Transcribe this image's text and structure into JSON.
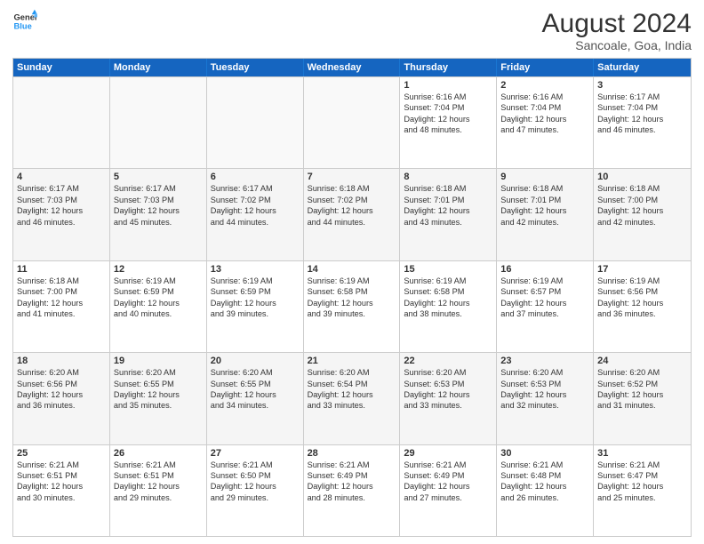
{
  "logo": {
    "line1": "General",
    "line2": "Blue"
  },
  "title": "August 2024",
  "subtitle": "Sancoale, Goa, India",
  "header_days": [
    "Sunday",
    "Monday",
    "Tuesday",
    "Wednesday",
    "Thursday",
    "Friday",
    "Saturday"
  ],
  "weeks": [
    [
      {
        "day": "",
        "info": ""
      },
      {
        "day": "",
        "info": ""
      },
      {
        "day": "",
        "info": ""
      },
      {
        "day": "",
        "info": ""
      },
      {
        "day": "1",
        "info": "Sunrise: 6:16 AM\nSunset: 7:04 PM\nDaylight: 12 hours\nand 48 minutes."
      },
      {
        "day": "2",
        "info": "Sunrise: 6:16 AM\nSunset: 7:04 PM\nDaylight: 12 hours\nand 47 minutes."
      },
      {
        "day": "3",
        "info": "Sunrise: 6:17 AM\nSunset: 7:04 PM\nDaylight: 12 hours\nand 46 minutes."
      }
    ],
    [
      {
        "day": "4",
        "info": "Sunrise: 6:17 AM\nSunset: 7:03 PM\nDaylight: 12 hours\nand 46 minutes."
      },
      {
        "day": "5",
        "info": "Sunrise: 6:17 AM\nSunset: 7:03 PM\nDaylight: 12 hours\nand 45 minutes."
      },
      {
        "day": "6",
        "info": "Sunrise: 6:17 AM\nSunset: 7:02 PM\nDaylight: 12 hours\nand 44 minutes."
      },
      {
        "day": "7",
        "info": "Sunrise: 6:18 AM\nSunset: 7:02 PM\nDaylight: 12 hours\nand 44 minutes."
      },
      {
        "day": "8",
        "info": "Sunrise: 6:18 AM\nSunset: 7:01 PM\nDaylight: 12 hours\nand 43 minutes."
      },
      {
        "day": "9",
        "info": "Sunrise: 6:18 AM\nSunset: 7:01 PM\nDaylight: 12 hours\nand 42 minutes."
      },
      {
        "day": "10",
        "info": "Sunrise: 6:18 AM\nSunset: 7:00 PM\nDaylight: 12 hours\nand 42 minutes."
      }
    ],
    [
      {
        "day": "11",
        "info": "Sunrise: 6:18 AM\nSunset: 7:00 PM\nDaylight: 12 hours\nand 41 minutes."
      },
      {
        "day": "12",
        "info": "Sunrise: 6:19 AM\nSunset: 6:59 PM\nDaylight: 12 hours\nand 40 minutes."
      },
      {
        "day": "13",
        "info": "Sunrise: 6:19 AM\nSunset: 6:59 PM\nDaylight: 12 hours\nand 39 minutes."
      },
      {
        "day": "14",
        "info": "Sunrise: 6:19 AM\nSunset: 6:58 PM\nDaylight: 12 hours\nand 39 minutes."
      },
      {
        "day": "15",
        "info": "Sunrise: 6:19 AM\nSunset: 6:58 PM\nDaylight: 12 hours\nand 38 minutes."
      },
      {
        "day": "16",
        "info": "Sunrise: 6:19 AM\nSunset: 6:57 PM\nDaylight: 12 hours\nand 37 minutes."
      },
      {
        "day": "17",
        "info": "Sunrise: 6:19 AM\nSunset: 6:56 PM\nDaylight: 12 hours\nand 36 minutes."
      }
    ],
    [
      {
        "day": "18",
        "info": "Sunrise: 6:20 AM\nSunset: 6:56 PM\nDaylight: 12 hours\nand 36 minutes."
      },
      {
        "day": "19",
        "info": "Sunrise: 6:20 AM\nSunset: 6:55 PM\nDaylight: 12 hours\nand 35 minutes."
      },
      {
        "day": "20",
        "info": "Sunrise: 6:20 AM\nSunset: 6:55 PM\nDaylight: 12 hours\nand 34 minutes."
      },
      {
        "day": "21",
        "info": "Sunrise: 6:20 AM\nSunset: 6:54 PM\nDaylight: 12 hours\nand 33 minutes."
      },
      {
        "day": "22",
        "info": "Sunrise: 6:20 AM\nSunset: 6:53 PM\nDaylight: 12 hours\nand 33 minutes."
      },
      {
        "day": "23",
        "info": "Sunrise: 6:20 AM\nSunset: 6:53 PM\nDaylight: 12 hours\nand 32 minutes."
      },
      {
        "day": "24",
        "info": "Sunrise: 6:20 AM\nSunset: 6:52 PM\nDaylight: 12 hours\nand 31 minutes."
      }
    ],
    [
      {
        "day": "25",
        "info": "Sunrise: 6:21 AM\nSunset: 6:51 PM\nDaylight: 12 hours\nand 30 minutes."
      },
      {
        "day": "26",
        "info": "Sunrise: 6:21 AM\nSunset: 6:51 PM\nDaylight: 12 hours\nand 29 minutes."
      },
      {
        "day": "27",
        "info": "Sunrise: 6:21 AM\nSunset: 6:50 PM\nDaylight: 12 hours\nand 29 minutes."
      },
      {
        "day": "28",
        "info": "Sunrise: 6:21 AM\nSunset: 6:49 PM\nDaylight: 12 hours\nand 28 minutes."
      },
      {
        "day": "29",
        "info": "Sunrise: 6:21 AM\nSunset: 6:49 PM\nDaylight: 12 hours\nand 27 minutes."
      },
      {
        "day": "30",
        "info": "Sunrise: 6:21 AM\nSunset: 6:48 PM\nDaylight: 12 hours\nand 26 minutes."
      },
      {
        "day": "31",
        "info": "Sunrise: 6:21 AM\nSunset: 6:47 PM\nDaylight: 12 hours\nand 25 minutes."
      }
    ]
  ]
}
